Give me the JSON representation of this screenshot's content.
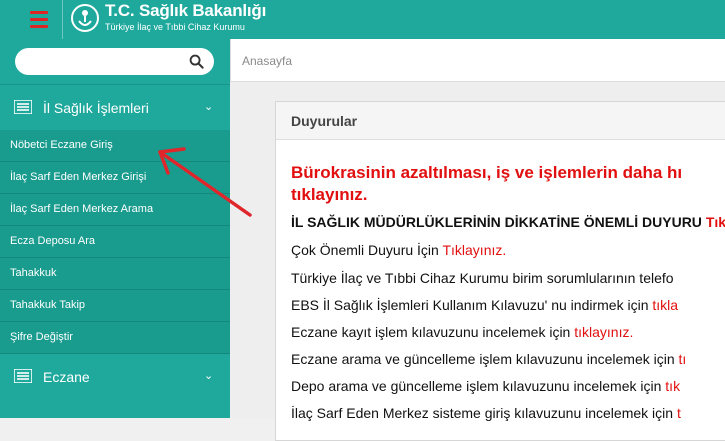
{
  "header": {
    "title": "T.C. Sağlık Bakanlığı",
    "subtitle": "Türkiye İlaç ve Tıbbi Cihaz Kurumu",
    "menu_icon": "hamburger-icon",
    "accent": "#1fa99c"
  },
  "sidebar": {
    "search": {
      "placeholder": "",
      "value": ""
    },
    "sections": [
      {
        "label": "İl Sağlık İşlemleri",
        "icon": "list-icon",
        "expanded": true
      },
      {
        "label": "Eczane",
        "icon": "list-icon",
        "expanded": false
      }
    ],
    "items": [
      {
        "label": "Nöbetci Eczane Giriş"
      },
      {
        "label": "İlaç Sarf Eden Merkez Girişi"
      },
      {
        "label": "İlaç Sarf Eden Merkez Arama"
      },
      {
        "label": "Ecza Deposu Ara"
      },
      {
        "label": "Tahakkuk"
      },
      {
        "label": "Tahakkuk Takip"
      },
      {
        "label": "Şifre Değiştir"
      }
    ]
  },
  "breadcrumb": "Anasayfa",
  "announcements": {
    "title": "Duyurular",
    "headline_line1": "Bürokrasinin azaltılması, iş ve işlemlerin daha hı",
    "headline_line2": "tıklayınız.",
    "lines": [
      {
        "text": "İL SAĞLIK MÜDÜRLÜKLERİNİN DİKKATİNE ÖNEMLİ DUYURU ",
        "link": "Tık",
        "bold": true
      },
      {
        "text": "Çok Önemli Duyuru İçin ",
        "link": "Tıklayınız.",
        "bold": false
      },
      {
        "text": "Türkiye İlaç ve Tıbbi Cihaz Kurumu birim sorumlularının telefo",
        "link": "",
        "bold": false
      },
      {
        "text": "EBS İl Sağlık İşlemleri Kullanım Kılavuzu' nu indirmek için ",
        "link": "tıkla",
        "bold": false
      },
      {
        "text": "Eczane kayıt işlem kılavuzunu incelemek için ",
        "link": "tıklayınız.",
        "bold": false
      },
      {
        "text": "Eczane arama ve güncelleme işlem kılavuzunu incelemek için ",
        "link": "tı",
        "bold": false
      },
      {
        "text": "Depo arama ve güncelleme işlem kılavuzunu incelemek için ",
        "link": "tık",
        "bold": false
      },
      {
        "text": "İlaç Sarf Eden Merkez sisteme giriş kılavuzunu incelemek için ",
        "link": "t",
        "bold": false
      }
    ]
  },
  "annotation": {
    "arrow_icon": "red-arrow-icon",
    "color": "#e0262a"
  }
}
